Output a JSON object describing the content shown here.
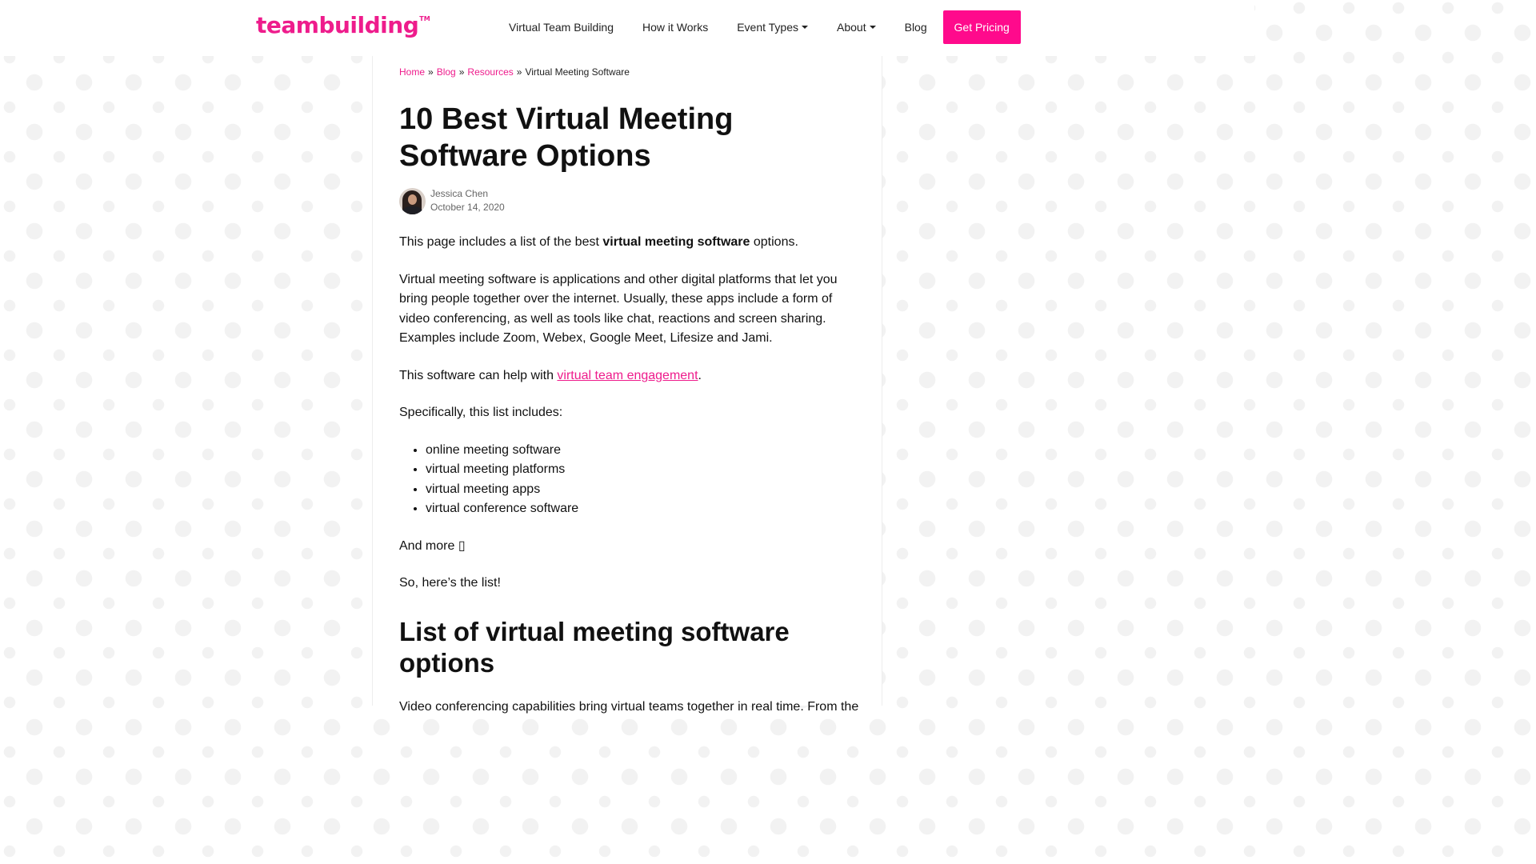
{
  "logo": {
    "text": "teambuilding",
    "tm": "TM"
  },
  "nav": {
    "links": [
      {
        "label": "Virtual Team Building"
      },
      {
        "label": "How it Works"
      },
      {
        "label": "Event Types"
      },
      {
        "label": "About"
      },
      {
        "label": "Blog"
      }
    ],
    "cta_label": "Get Pricing"
  },
  "breadcrumb": {
    "items": [
      "Home",
      "Blog",
      "Resources"
    ],
    "current": "Virtual Meeting Software",
    "separator": "»"
  },
  "article": {
    "title": "10 Best Virtual Meeting Software Options",
    "author_name": "Jessica Chen",
    "date": "October 14, 2020",
    "p1_before": "This page includes a list of the best ",
    "p1_bold": "virtual meeting software",
    "p1_after": " options.",
    "p2": "Virtual meeting software is applications and other digital platforms that let you bring people together over the internet. Usually, these apps include a form of video conferencing, as well as tools like chat, reactions and screen sharing. Examples include Zoom, Webex, Google Meet, Lifesize and Jami.",
    "p3_before": "This software can help with ",
    "p3_link": "virtual team engagement",
    "p3_after": ".",
    "p4": "Specifically, this list includes:",
    "list": [
      "online meeting software",
      "virtual meeting platforms",
      "virtual meeting apps",
      "virtual conference software"
    ],
    "p5": "And more ",
    "p6": "So, here’s the list!",
    "h2": "List of virtual meeting software options",
    "p7": "Video conferencing capabilities bring virtual teams together in real time. From the"
  },
  "colors": {
    "brand": "#ee1c8c",
    "cta_bg": "#ff0a8c"
  }
}
